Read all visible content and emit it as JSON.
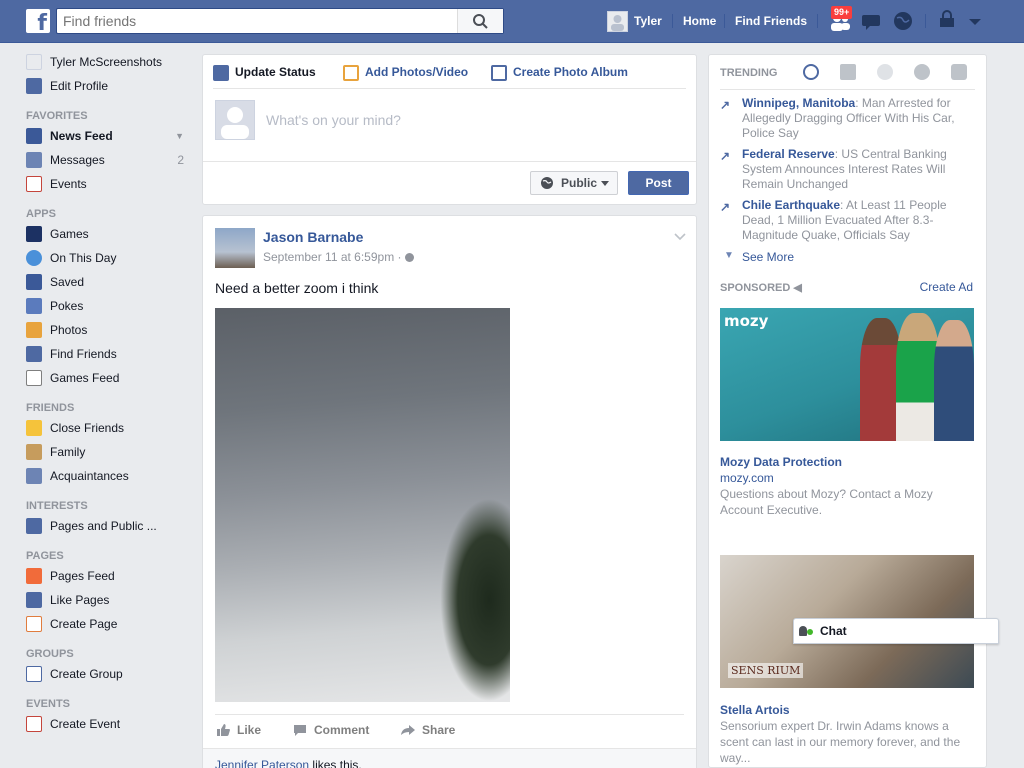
{
  "topbar": {
    "logo": "f",
    "search_placeholder": "Find friends",
    "user_name": "Tyler",
    "home": "Home",
    "find_friends": "Find Friends",
    "notifications_badge": "99+"
  },
  "left_nav": {
    "profile_name": "Tyler McScreenshots",
    "edit_profile": "Edit Profile",
    "favorites_heading": "FAVORITES",
    "news_feed": "News Feed",
    "messages": "Messages",
    "messages_count": "2",
    "events": "Events",
    "apps_heading": "APPS",
    "games": "Games",
    "on_this_day": "On This Day",
    "saved": "Saved",
    "pokes": "Pokes",
    "photos": "Photos",
    "find_friends": "Find Friends",
    "games_feed": "Games Feed",
    "friends_heading": "FRIENDS",
    "close_friends": "Close Friends",
    "family": "Family",
    "acquaintances": "Acquaintances",
    "interests_heading": "INTERESTS",
    "pages_and_public": "Pages and Public ...",
    "pages_heading": "PAGES",
    "pages_feed": "Pages Feed",
    "like_pages": "Like Pages",
    "create_page": "Create Page",
    "groups_heading": "GROUPS",
    "create_group": "Create Group",
    "events_heading": "EVENTS",
    "create_event": "Create Event"
  },
  "composer": {
    "update_status": "Update Status",
    "add_photos": "Add Photos/Video",
    "create_album": "Create Photo Album",
    "placeholder": "What's on your mind?",
    "audience": "Public",
    "post": "Post"
  },
  "post": {
    "author": "Jason Barnabe",
    "time": "September 11 at 6:59pm · ",
    "text": "Need a better zoom i think",
    "like": "Like",
    "comment": "Comment",
    "share": "Share",
    "liker": "Jennifer Paterson",
    "likes_suffix": " likes this."
  },
  "trending": {
    "heading": "TRENDING",
    "items": [
      {
        "topic": "Winnipeg, Manitoba",
        "desc": ": Man Arrested for Allegedly Dragging Officer With His Car, Police Say"
      },
      {
        "topic": "Federal Reserve",
        "desc": ": US Central Banking System Announces Interest Rates Will Remain Unchanged"
      },
      {
        "topic": "Chile Earthquake",
        "desc": ": At Least 11 People Dead, 1 Million Evacuated After 8.3-Magnitude Quake, Officials Say"
      }
    ],
    "see_more": "See More"
  },
  "sponsored": {
    "heading": "SPONSORED",
    "create_ad": "Create Ad",
    "ads": [
      {
        "logo": "mozy",
        "title": "Mozy Data Protection",
        "domain": "mozy.com",
        "desc": "Questions about Mozy? Contact a Mozy Account Executive."
      },
      {
        "brand": "SENS  RIUM",
        "title": "Stella Artois",
        "desc": "Sensorium expert Dr. Irwin Adams knows a scent can last in our memory forever, and the way..."
      }
    ]
  },
  "chat": {
    "label": "Chat"
  },
  "colors": {
    "brand": "#4e69a2",
    "link": "#365899",
    "badge": "#fa3e3e"
  }
}
